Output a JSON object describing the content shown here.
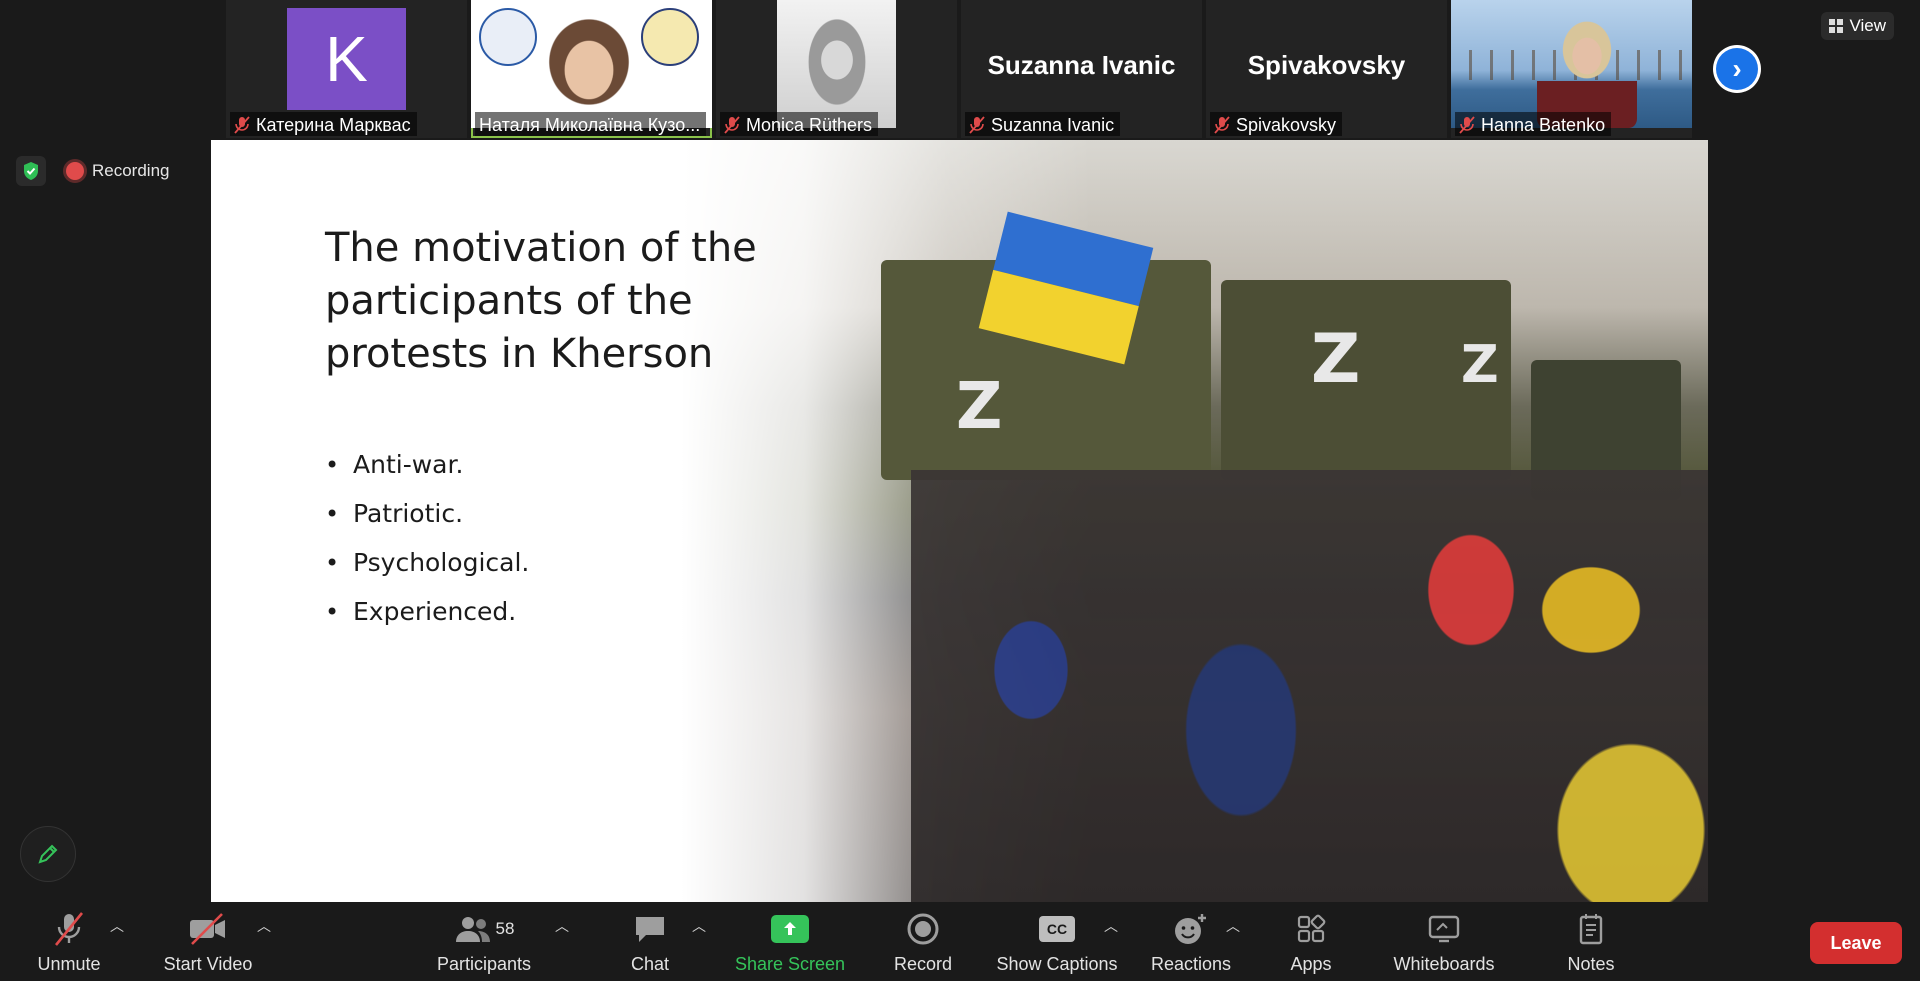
{
  "participants": [
    {
      "name": "Катерина Маркваc",
      "avatar_letter": "K",
      "avatar_color": "#7b4fc6",
      "muted": true
    },
    {
      "name": "Наталя Миколаївна Кузо...",
      "muted": false,
      "active_speaker": true
    },
    {
      "name": "Monica Rüthers",
      "muted": true
    },
    {
      "name": "Suzanna Ivanic",
      "display_name": "Suzanna Ivanic",
      "muted": true
    },
    {
      "name": "Spivakovsky",
      "display_name": "Spivakovsky",
      "muted": true
    },
    {
      "name": "Hanna Batenko",
      "muted": true
    }
  ],
  "top_right": {
    "view_label": "View"
  },
  "status": {
    "recording_label": "Recording"
  },
  "slide": {
    "title": "The motivation of the participants of the protests in Kherson",
    "bullets": [
      "Anti-war.",
      " Patriotic.",
      "Psychological.",
      "Experienced."
    ],
    "photo_truck_mark": "Z"
  },
  "toolbar": {
    "unmute": "Unmute",
    "start_video": "Start Video",
    "participants": "Participants",
    "participants_count": "58",
    "chat": "Chat",
    "share_screen": "Share Screen",
    "record": "Record",
    "show_captions": "Show Captions",
    "captions_badge": "CC",
    "reactions": "Reactions",
    "apps": "Apps",
    "whiteboards": "Whiteboards",
    "notes": "Notes",
    "leave": "Leave"
  },
  "colors": {
    "accent_blue": "#1a73e8",
    "share_green": "#35c35a",
    "leave_red": "#d32f2f",
    "active_border": "#8bc34a"
  }
}
